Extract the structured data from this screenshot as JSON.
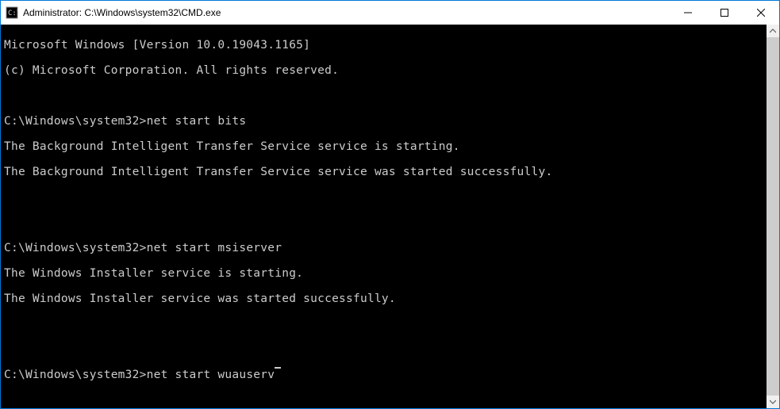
{
  "titlebar": {
    "title": "Administrator: C:\\Windows\\system32\\CMD.exe"
  },
  "console": {
    "header1": "Microsoft Windows [Version 10.0.19043.1165]",
    "header2": "(c) Microsoft Corporation. All rights reserved.",
    "prompt": "C:\\Windows\\system32>",
    "blocks": [
      {
        "command": "net start bits",
        "out1": "The Background Intelligent Transfer Service service is starting.",
        "out2": "The Background Intelligent Transfer Service service was started successfully."
      },
      {
        "command": "net start msiserver",
        "out1": "The Windows Installer service is starting.",
        "out2": "The Windows Installer service was started successfully."
      }
    ],
    "current_command": "net start wuauserv"
  }
}
